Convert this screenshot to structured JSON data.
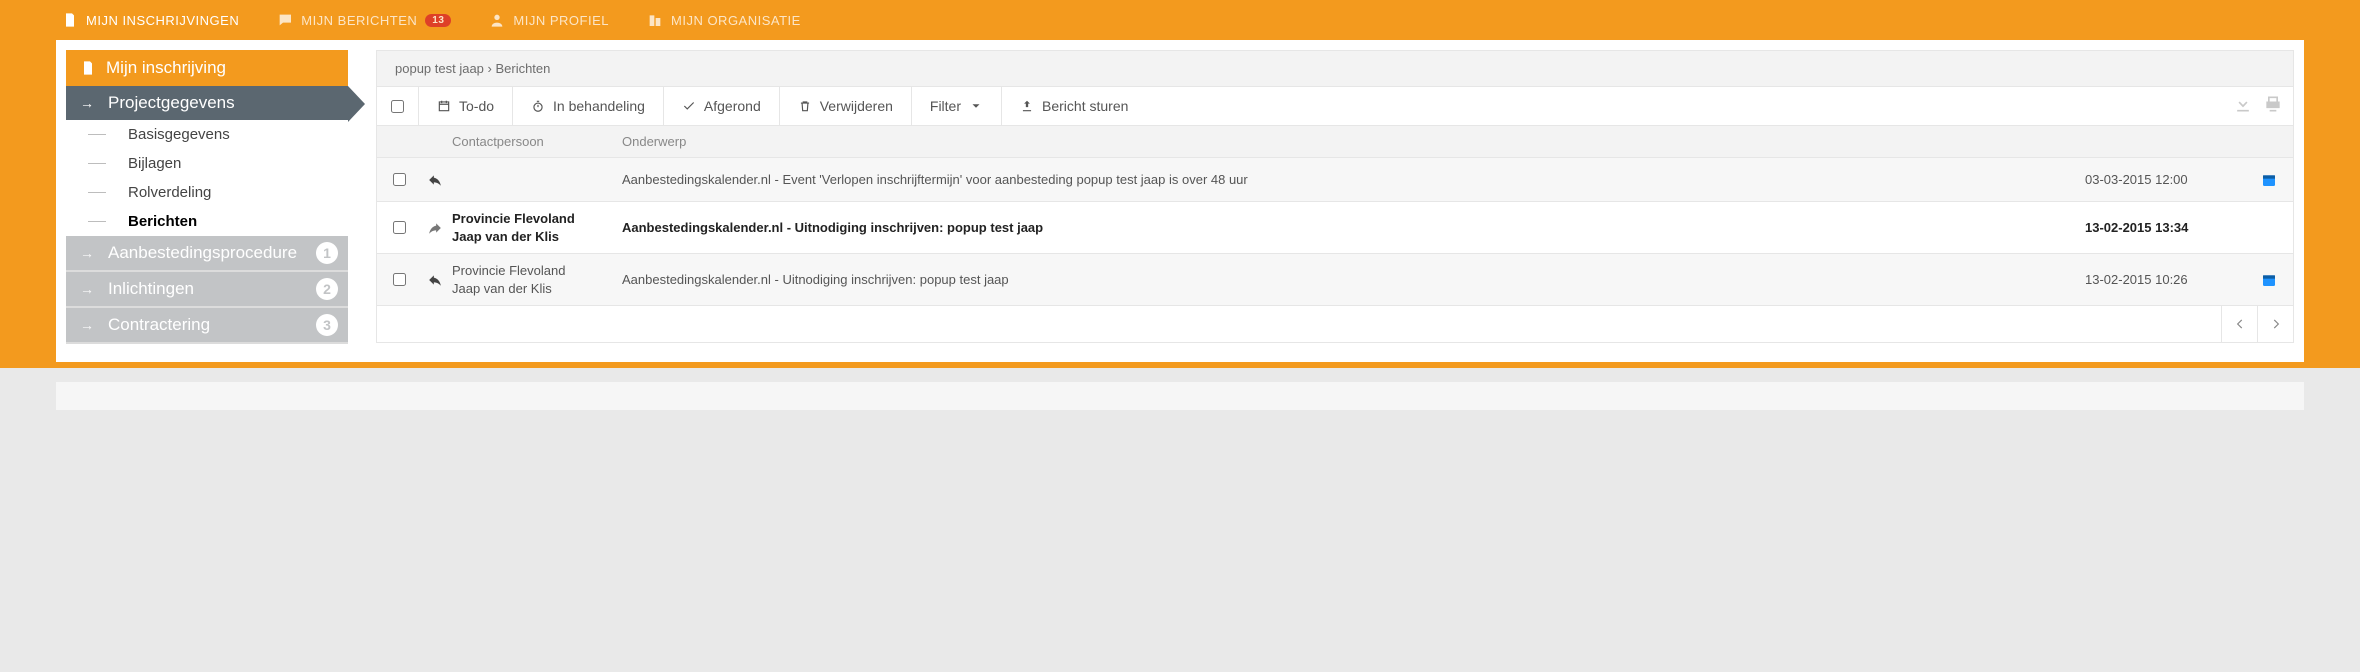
{
  "topnav": {
    "inschrijvingen": "MIJN INSCHRIJVINGEN",
    "berichten": "MIJN BERICHTEN",
    "berichten_badge": "13",
    "profiel": "MIJN PROFIEL",
    "organisatie": "MIJN ORGANISATIE"
  },
  "sidebar": {
    "header": "Mijn inschrijving",
    "project": "Projectgegevens",
    "subs": {
      "basis": "Basisgegevens",
      "bijlagen": "Bijlagen",
      "rol": "Rolverdeling",
      "berichten": "Berichten"
    },
    "dim": {
      "aanb": "Aanbestedingsprocedure",
      "aanb_n": "1",
      "inl": "Inlichtingen",
      "inl_n": "2",
      "contr": "Contractering",
      "contr_n": "3"
    }
  },
  "breadcrumb": "popup test jaap › Berichten",
  "toolbar": {
    "todo": "To-do",
    "behandeling": "In behandeling",
    "afgerond": "Afgerond",
    "verwijderen": "Verwijderen",
    "filter": "Filter",
    "sturen": "Bericht sturen"
  },
  "cols": {
    "contact": "Contactpersoon",
    "onderwerp": "Onderwerp"
  },
  "rows": [
    {
      "contact_org": "",
      "contact_name": "",
      "subject": "Aanbestedingskalender.nl - Event 'Verlopen inschrijftermijn' voor aanbesteding popup test jaap is over 48 uur",
      "date": "03-03-2015 12:00",
      "icon": "reply",
      "unread": false,
      "cal": true
    },
    {
      "contact_org": "Provincie Flevoland",
      "contact_name": "Jaap van der Klis",
      "subject": "Aanbestedingskalender.nl - Uitnodiging inschrijven: popup test jaap",
      "date": "13-02-2015 13:34",
      "icon": "forward",
      "unread": true,
      "cal": false
    },
    {
      "contact_org": "Provincie Flevoland",
      "contact_name": "Jaap van der Klis",
      "subject": "Aanbestedingskalender.nl - Uitnodiging inschrijven: popup test jaap",
      "date": "13-02-2015 10:26",
      "icon": "reply",
      "unread": false,
      "cal": true
    }
  ]
}
